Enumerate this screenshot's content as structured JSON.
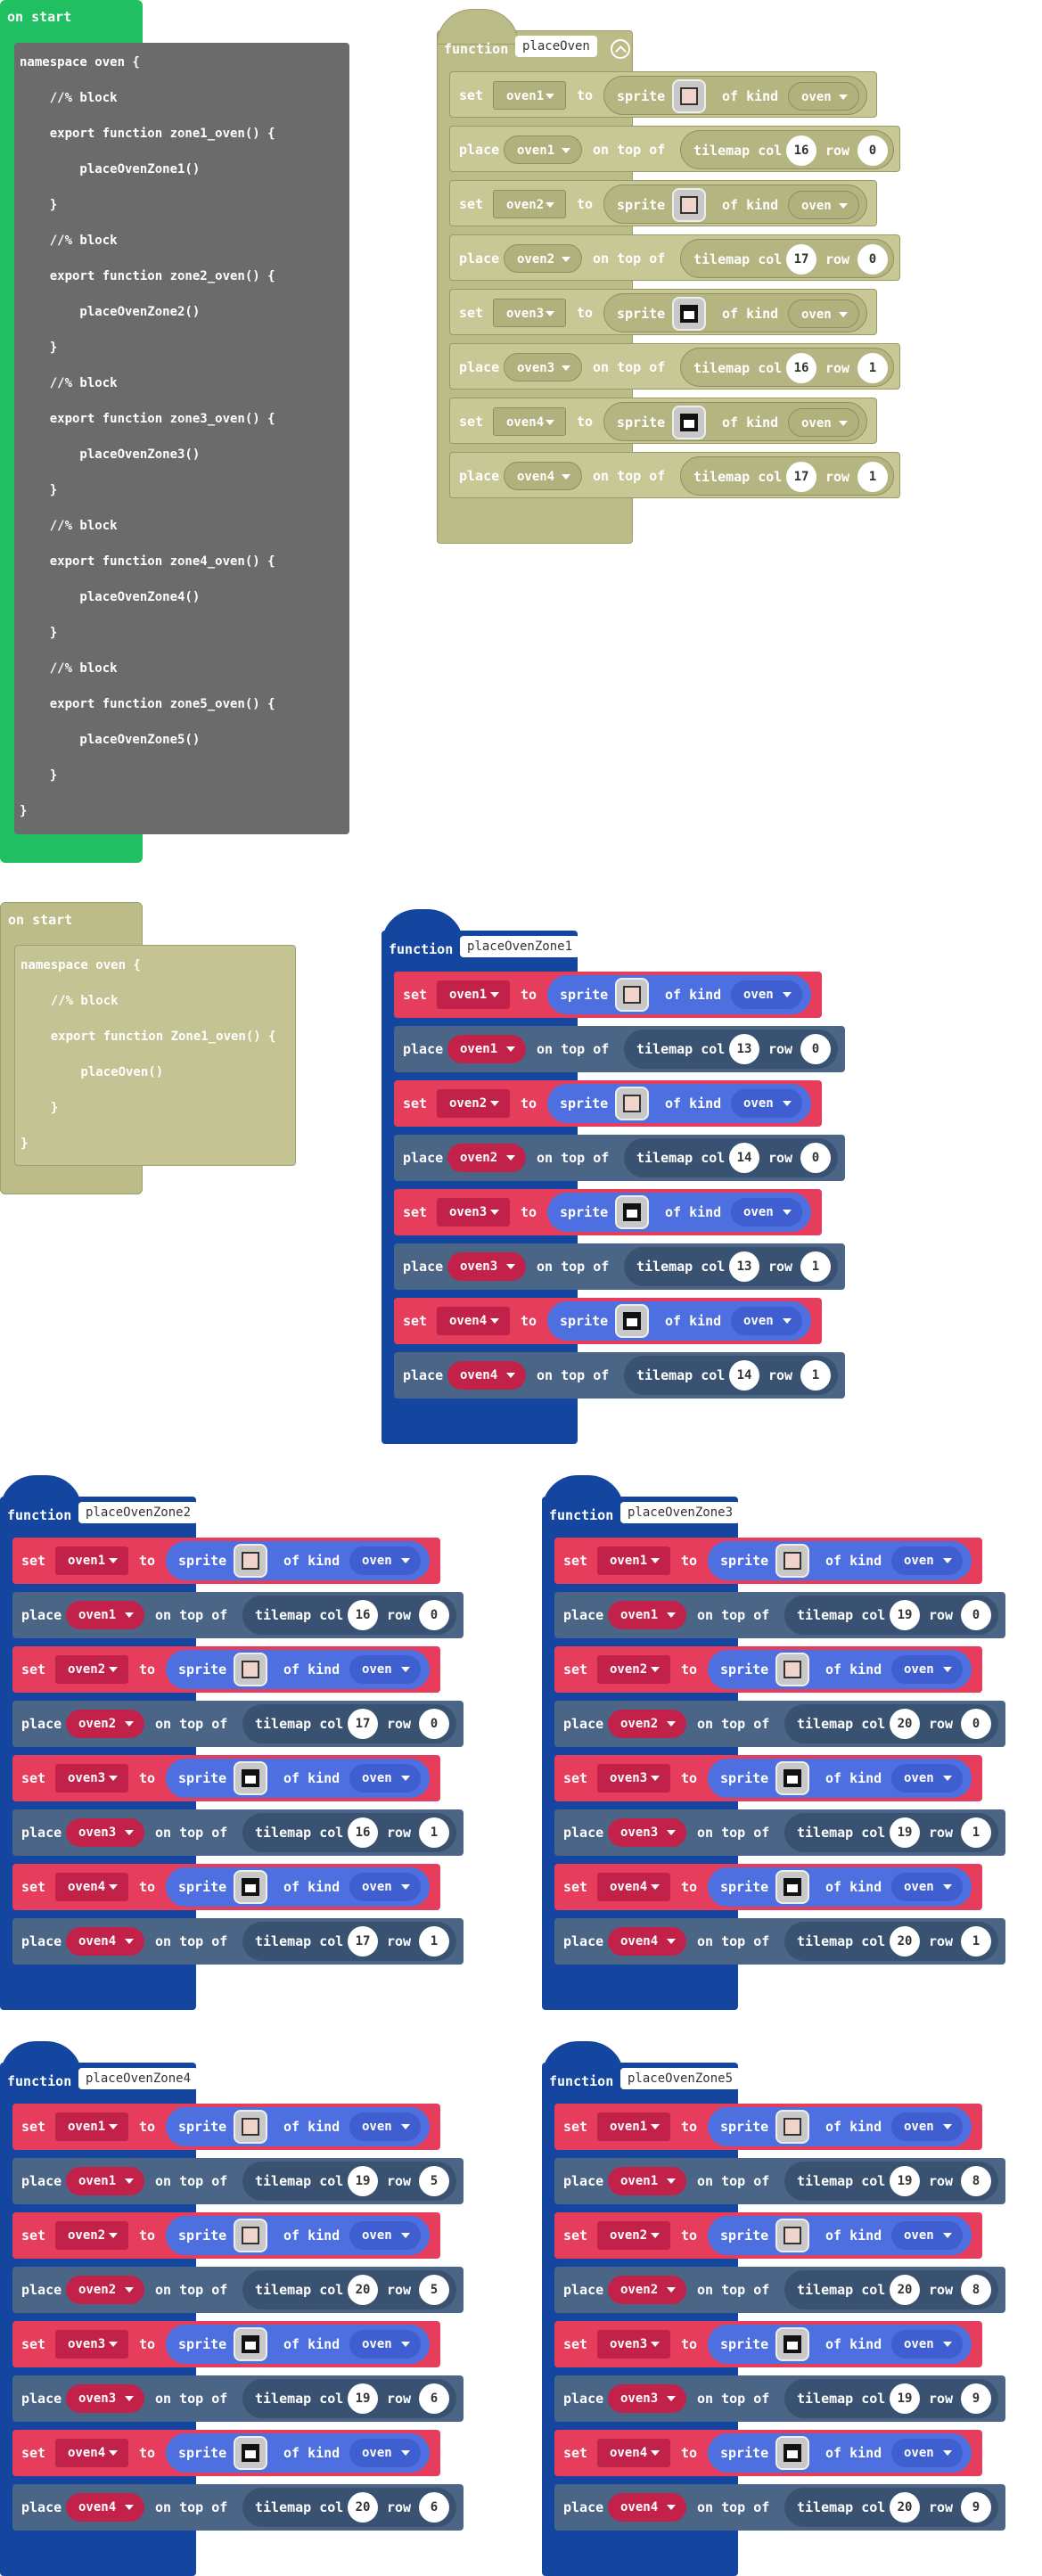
{
  "kw": {
    "on_start": "on start",
    "function": "function",
    "set": "set",
    "to": "to",
    "sprite": "sprite",
    "of_kind": "of kind",
    "place": "place",
    "on_top_of": "on top of",
    "tilemap_col": "tilemap col",
    "row": "row",
    "kind": "oven"
  },
  "code1": [
    "namespace oven {",
    "    //% block",
    "    export function zone1_oven() {",
    "        placeOvenZone1()",
    "    }",
    "    //% block",
    "    export function zone2_oven() {",
    "        placeOvenZone2()",
    "    }",
    "    //% block",
    "    export function zone3_oven() {",
    "        placeOvenZone3()",
    "    }",
    "    //% block",
    "    export function zone4_oven() {",
    "        placeOvenZone4()",
    "    }",
    "    //% block",
    "    export function zone5_oven() {",
    "        placeOvenZone5()",
    "    }",
    "}"
  ],
  "code2": [
    "namespace oven {",
    "    //% block",
    "    export function Zone1_oven() {",
    "        placeOven()",
    "    }",
    "}"
  ],
  "functions": [
    {
      "name": "placeOven",
      "style": "olive",
      "cells": [
        [
          16,
          0
        ],
        [
          17,
          0
        ],
        [
          16,
          1
        ],
        [
          17,
          1
        ]
      ]
    },
    {
      "name": "placeOvenZone1",
      "style": "color",
      "cells": [
        [
          13,
          0
        ],
        [
          14,
          0
        ],
        [
          13,
          1
        ],
        [
          14,
          1
        ]
      ]
    },
    {
      "name": "placeOvenZone2",
      "style": "color",
      "cells": [
        [
          16,
          0
        ],
        [
          17,
          0
        ],
        [
          16,
          1
        ],
        [
          17,
          1
        ]
      ]
    },
    {
      "name": "placeOvenZone3",
      "style": "color",
      "cells": [
        [
          19,
          0
        ],
        [
          20,
          0
        ],
        [
          19,
          1
        ],
        [
          20,
          1
        ]
      ]
    },
    {
      "name": "placeOvenZone4",
      "style": "color",
      "cells": [
        [
          19,
          5
        ],
        [
          20,
          5
        ],
        [
          19,
          6
        ],
        [
          20,
          6
        ]
      ]
    },
    {
      "name": "placeOvenZone5",
      "style": "color",
      "cells": [
        [
          19,
          8
        ],
        [
          20,
          8
        ],
        [
          19,
          9
        ],
        [
          20,
          9
        ]
      ]
    }
  ],
  "vars": [
    "oven1",
    "oven2",
    "oven3",
    "oven4"
  ]
}
